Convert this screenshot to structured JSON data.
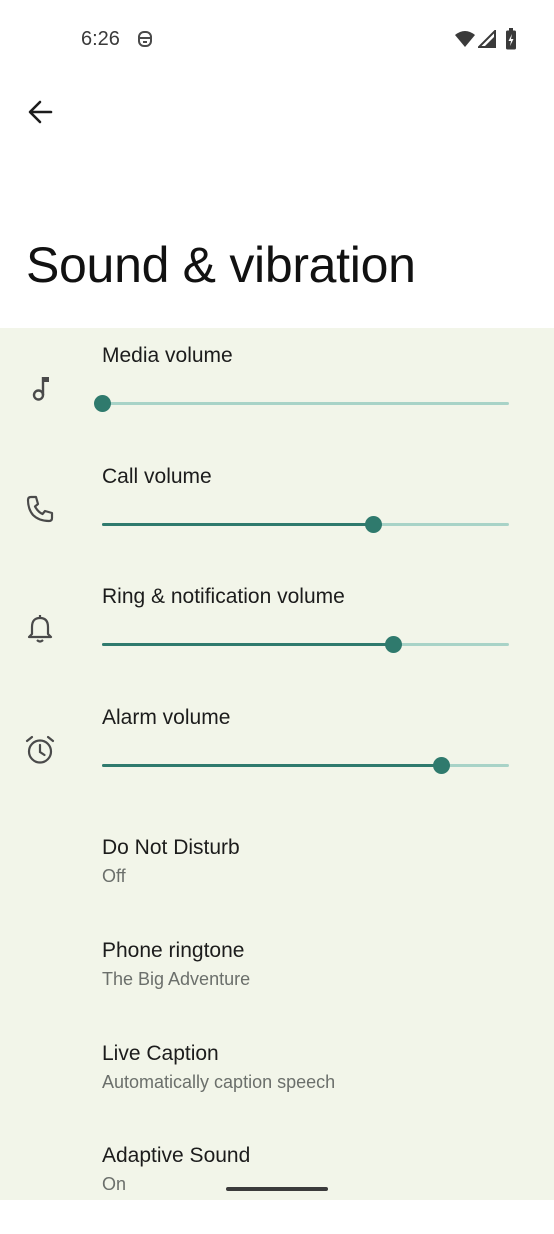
{
  "status_bar": {
    "time": "6:26",
    "icons": [
      "notification-icon",
      "wifi-icon",
      "cell-signal-icon",
      "battery-icon"
    ]
  },
  "header": {
    "back_icon": "arrow-back-icon",
    "title": "Sound & vibration"
  },
  "volume_sliders": [
    {
      "label": "Media volume",
      "icon": "music-note-icon",
      "level": 0.0
    },
    {
      "label": "Call volume",
      "icon": "phone-icon",
      "level": 0.667
    },
    {
      "label": "Ring & notification volume",
      "icon": "bell-icon",
      "level": 0.714
    },
    {
      "label": "Alarm volume",
      "icon": "alarm-clock-icon",
      "level": 0.833
    }
  ],
  "preferences": [
    {
      "title": "Do Not Disturb",
      "summary": "Off"
    },
    {
      "title": "Phone ringtone",
      "summary": "The Big Adventure"
    },
    {
      "title": "Live Caption",
      "summary": "Automatically caption speech"
    },
    {
      "title": "Adaptive Sound",
      "summary": "On"
    }
  ],
  "colors": {
    "accent": "#2f7a6d",
    "track_inactive": "#a8d3c7",
    "content_background": "#f2f5e9"
  }
}
